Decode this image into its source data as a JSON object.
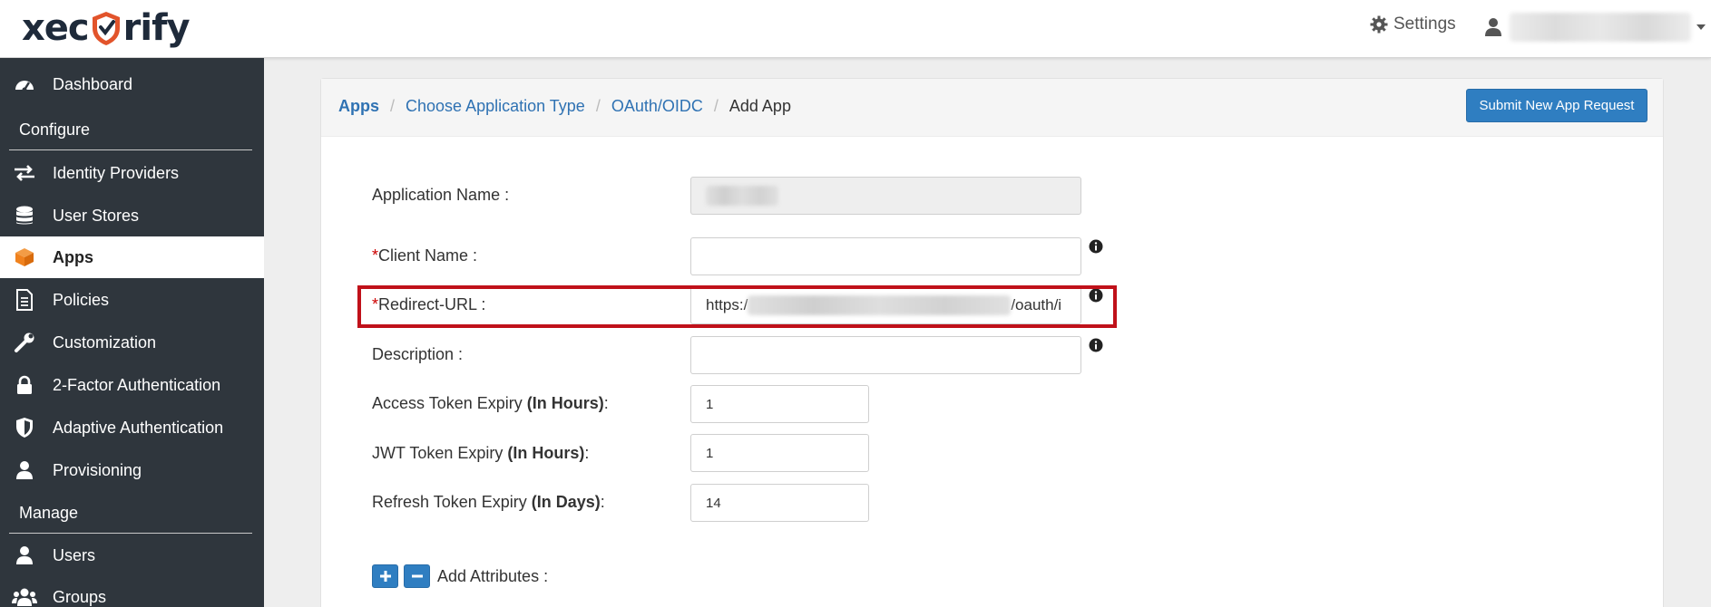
{
  "header": {
    "logo_text_left": "xec",
    "logo_text_right": "rify",
    "settings_label": "Settings"
  },
  "sidebar": {
    "items": [
      {
        "label": "Dashboard",
        "icon": "dashboard-icon"
      },
      {
        "label": "Identity Providers",
        "icon": "exchange-icon"
      },
      {
        "label": "User Stores",
        "icon": "database-icon"
      },
      {
        "label": "Apps",
        "icon": "cube-icon",
        "active": true
      },
      {
        "label": "Policies",
        "icon": "document-icon"
      },
      {
        "label": "Customization",
        "icon": "wrench-icon"
      },
      {
        "label": "2-Factor Authentication",
        "icon": "lock-icon"
      },
      {
        "label": "Adaptive Authentication",
        "icon": "shield-icon"
      },
      {
        "label": "Provisioning",
        "icon": "user-icon"
      },
      {
        "label": "Users",
        "icon": "user-icon"
      },
      {
        "label": "Groups",
        "icon": "users-icon"
      }
    ],
    "sections": {
      "configure": "Configure",
      "manage": "Manage"
    }
  },
  "breadcrumb": {
    "apps": "Apps",
    "choose_type": "Choose Application Type",
    "oauth": "OAuth/OIDC",
    "current": "Add App",
    "separator": "/"
  },
  "submit_button": "Submit New App Request",
  "form": {
    "application_name_label": "Application Name :",
    "client_name_label": "Client Name :",
    "redirect_url_label": "Redirect-URL :",
    "redirect_url_prefix": "https:/",
    "redirect_url_suffix": "/oauth/i",
    "description_label": "Description :",
    "access_token_label": "Access Token Expiry ",
    "access_token_unit": "(In Hours)",
    "access_token_value": "1",
    "jwt_token_label": "JWT Token Expiry ",
    "jwt_token_unit": "(In Hours)",
    "jwt_token_value": "1",
    "refresh_token_label": "Refresh Token Expiry ",
    "refresh_token_unit": "(In Days)",
    "refresh_token_value": "14",
    "required_marker": "*",
    "colon": ":",
    "add_attributes_label": "Add Attributes :"
  },
  "colors": {
    "sidebar_bg": "#2f363d",
    "accent_blue": "#2f7ec1",
    "link_blue": "#2f72b3",
    "highlight_red": "#c0111a",
    "apps_icon_orange": "#f0821e"
  }
}
